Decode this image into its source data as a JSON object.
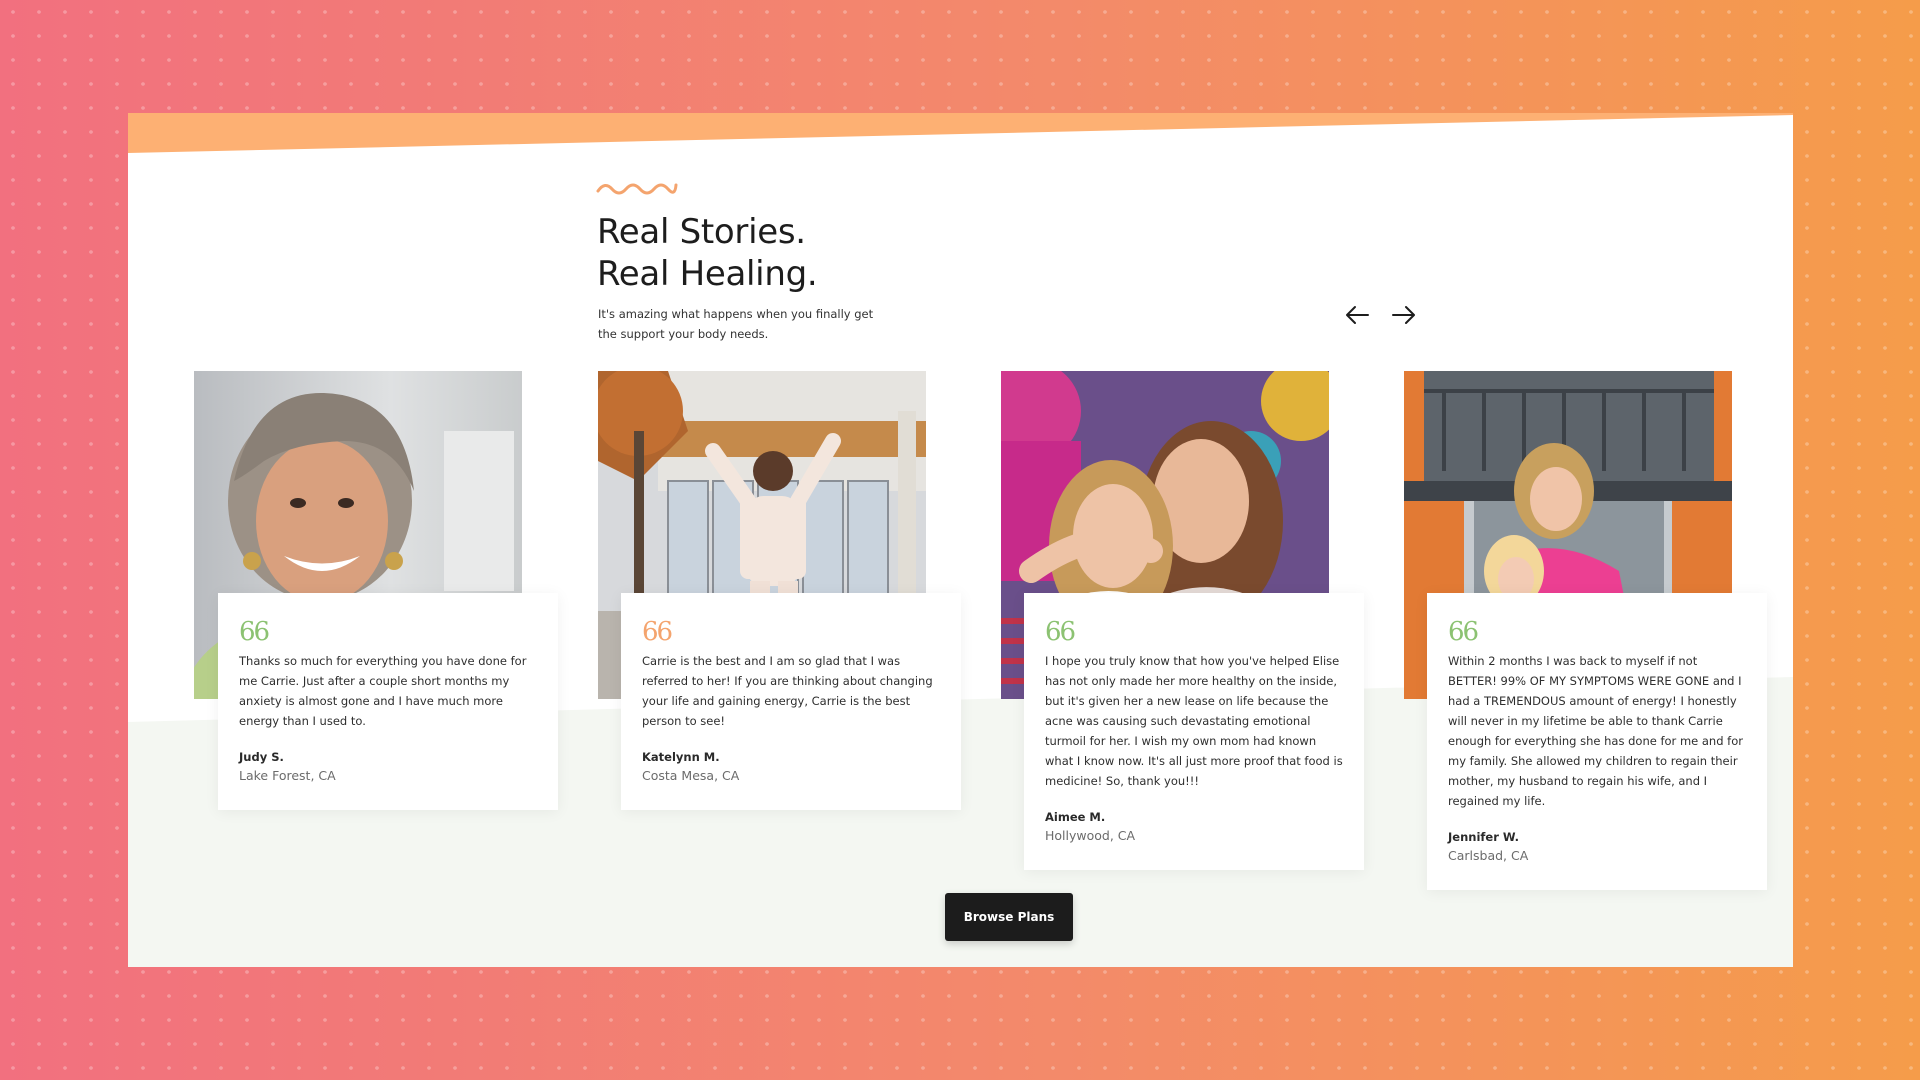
{
  "section": {
    "heading_line1": "Real Stories.",
    "heading_line2": "Real Healing.",
    "subtitle_line1": "It's amazing what happens when you finally get",
    "subtitle_line2": "the support your body needs."
  },
  "carousel": {
    "prev_icon": "arrow-left-icon",
    "next_icon": "arrow-right-icon"
  },
  "testimonials": [
    {
      "quote_mark": "66",
      "quote": "Thanks so much for everything you have done for me Carrie. Just after a couple short months my anxiety is almost gone and I have much more energy than I used to.",
      "name": "Judy S.",
      "location": "Lake Forest, CA",
      "quote_color": "#8cc272"
    },
    {
      "quote_mark": "66",
      "quote": "Carrie is the best and I am so glad that I was referred to her! If you are thinking about changing your life and gaining energy, Carrie is the best person to see!",
      "name": "Katelynn M.",
      "location": "Costa Mesa, CA",
      "quote_color": "#f4a46e"
    },
    {
      "quote_mark": "66",
      "quote": "I hope you truly know that how you've helped Elise has not only made her more healthy on the inside, but it's given her a new lease on life because the acne was causing such devastating emotional turmoil for her. I wish my own mom had known what I know now. It's all just more proof that food is medicine! So, thank you!!!",
      "name": "Aimee M.",
      "location": "Hollywood, CA",
      "quote_color": "#8cc272"
    },
    {
      "quote_mark": "66",
      "quote": "Within 2 months I was back to myself if not BETTER! 99% OF MY SYMPTOMS WERE GONE and I had a TREMENDOUS amount of energy! I honestly will never in my lifetime be able to thank Carrie enough for everything she has done for me and for my family. She allowed my children to regain their mother, my husband to regain his wife, and I regained my life.",
      "name": "Jennifer W.",
      "location": "Carlsbad, CA",
      "quote_color": "#8cc272"
    }
  ],
  "cta": {
    "label": "Browse Plans"
  },
  "colors": {
    "accent_orange": "#f4a46e",
    "accent_green": "#8cc272",
    "panel_bottom": "#f4f7f2",
    "button_bg": "#1c1c1c"
  }
}
